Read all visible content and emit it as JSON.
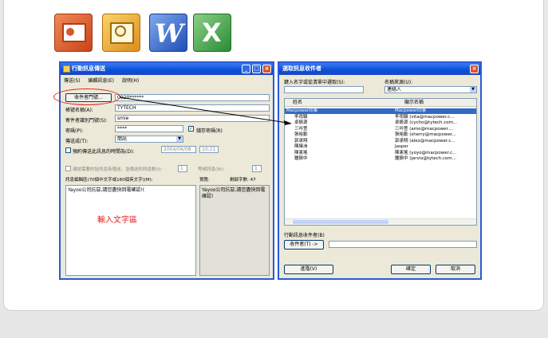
{
  "apps": [
    {
      "name": "PowerPoint",
      "color": "#d7562e"
    },
    {
      "name": "Outlook",
      "color": "#e8a42a"
    },
    {
      "name": "Word",
      "color": "#2b63c6"
    },
    {
      "name": "Excel",
      "color": "#2e9b3c"
    }
  ],
  "send_window": {
    "title": "行動訊息傳送",
    "menu": {
      "send": "傳送(S)",
      "edit": "編輯訊息(E)",
      "help": "說明(H)"
    },
    "recipient_button": "收件者門號...",
    "recipient_value": "0920******",
    "account_label": "帳號名稱(A):",
    "account_value": "TYTECH",
    "sender_id_label": "寄件者識別門號(S):",
    "sender_id_value": "smie",
    "password_label": "密碼(P):",
    "password_value": "****",
    "save_password": "儲存密碼(R)",
    "send_mode_label": "傳送成(T):",
    "send_mode_value": "簡訊",
    "schedule_label": "預約傳送此訊息的時間為(D):",
    "schedule_date": "2004/06/08",
    "schedule_time": "10:21",
    "long_msg_label": "連結需要的話訊息拆傳送，並傳送的訊息數(I):",
    "long_msg_num": "1",
    "resend_label": "等候訊息(W):",
    "resend_num": "1",
    "edit_area_label": "訊息編輯區(70個中文字或160個英文字)(M):",
    "preview_label": "預覽:",
    "count_label": "剩餘字數: 47",
    "message_text": "Yayoo公司抗惡,請您盡快回電確認!(",
    "preview_text": "Yayoo公司抗惡,請您盡快回電確認!",
    "annotation": "輸入文字區"
  },
  "contact_window": {
    "title": "選取訊息收件者",
    "search_label": "鍵入名字或從清單中選取(S):",
    "source_label": "名稱來源(U):",
    "source_value": "連絡人",
    "col_name": "姓名",
    "col_display": "顯示名稱",
    "contacts": [
      {
        "name": "Macpower同事",
        "display": "Macpower同事",
        "selected": true
      },
      {
        "name": "李雨穎",
        "display": "李雨穎 (vita@macpower.c..."
      },
      {
        "name": "卓振源",
        "display": "卓振源 (cycho@tytech.com..."
      },
      {
        "name": "三吟萱",
        "display": "三吟萱 (amo@macpower...."
      },
      {
        "name": "張裕勤",
        "display": "張裕勤 (sherry@macpower..."
      },
      {
        "name": "郭承翔",
        "display": "郭承翔 (alex@macpower.c..."
      },
      {
        "name": "陳緯洲",
        "display": "Jasper"
      },
      {
        "name": "陳憲瑤",
        "display": "陳憲瑤 (yoyo@macpower.c..."
      },
      {
        "name": "鍾振中",
        "display": "鍾振中 (jarvis@tytech.com..."
      }
    ],
    "recipients_label": "行動訊息收件者(B)",
    "recipients_button": "收件者(T) ->",
    "advanced_button": "進階(V)",
    "ok_button": "確定",
    "cancel_button": "取消"
  }
}
